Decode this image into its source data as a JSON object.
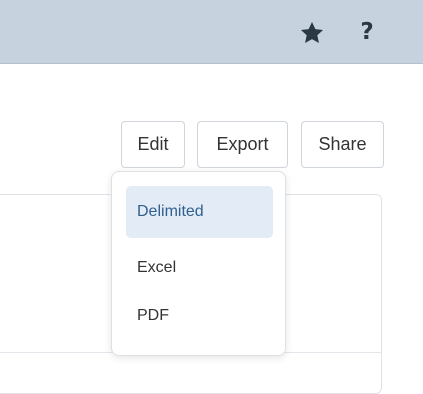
{
  "header": {
    "star_icon": "star-icon",
    "help_icon": "help-icon",
    "help_label": "?"
  },
  "actions": {
    "edit_label": "Edit",
    "export_label": "Export",
    "share_label": "Share"
  },
  "export_menu": {
    "items": [
      {
        "label": "Delimited",
        "selected": true
      },
      {
        "label": "Excel",
        "selected": false
      },
      {
        "label": "PDF",
        "selected": false
      }
    ]
  },
  "colors": {
    "topbar": "#c6d3de",
    "icon": "#2b3945",
    "selected_bg": "#e2ebf6",
    "selected_text": "#2f5f8f"
  }
}
